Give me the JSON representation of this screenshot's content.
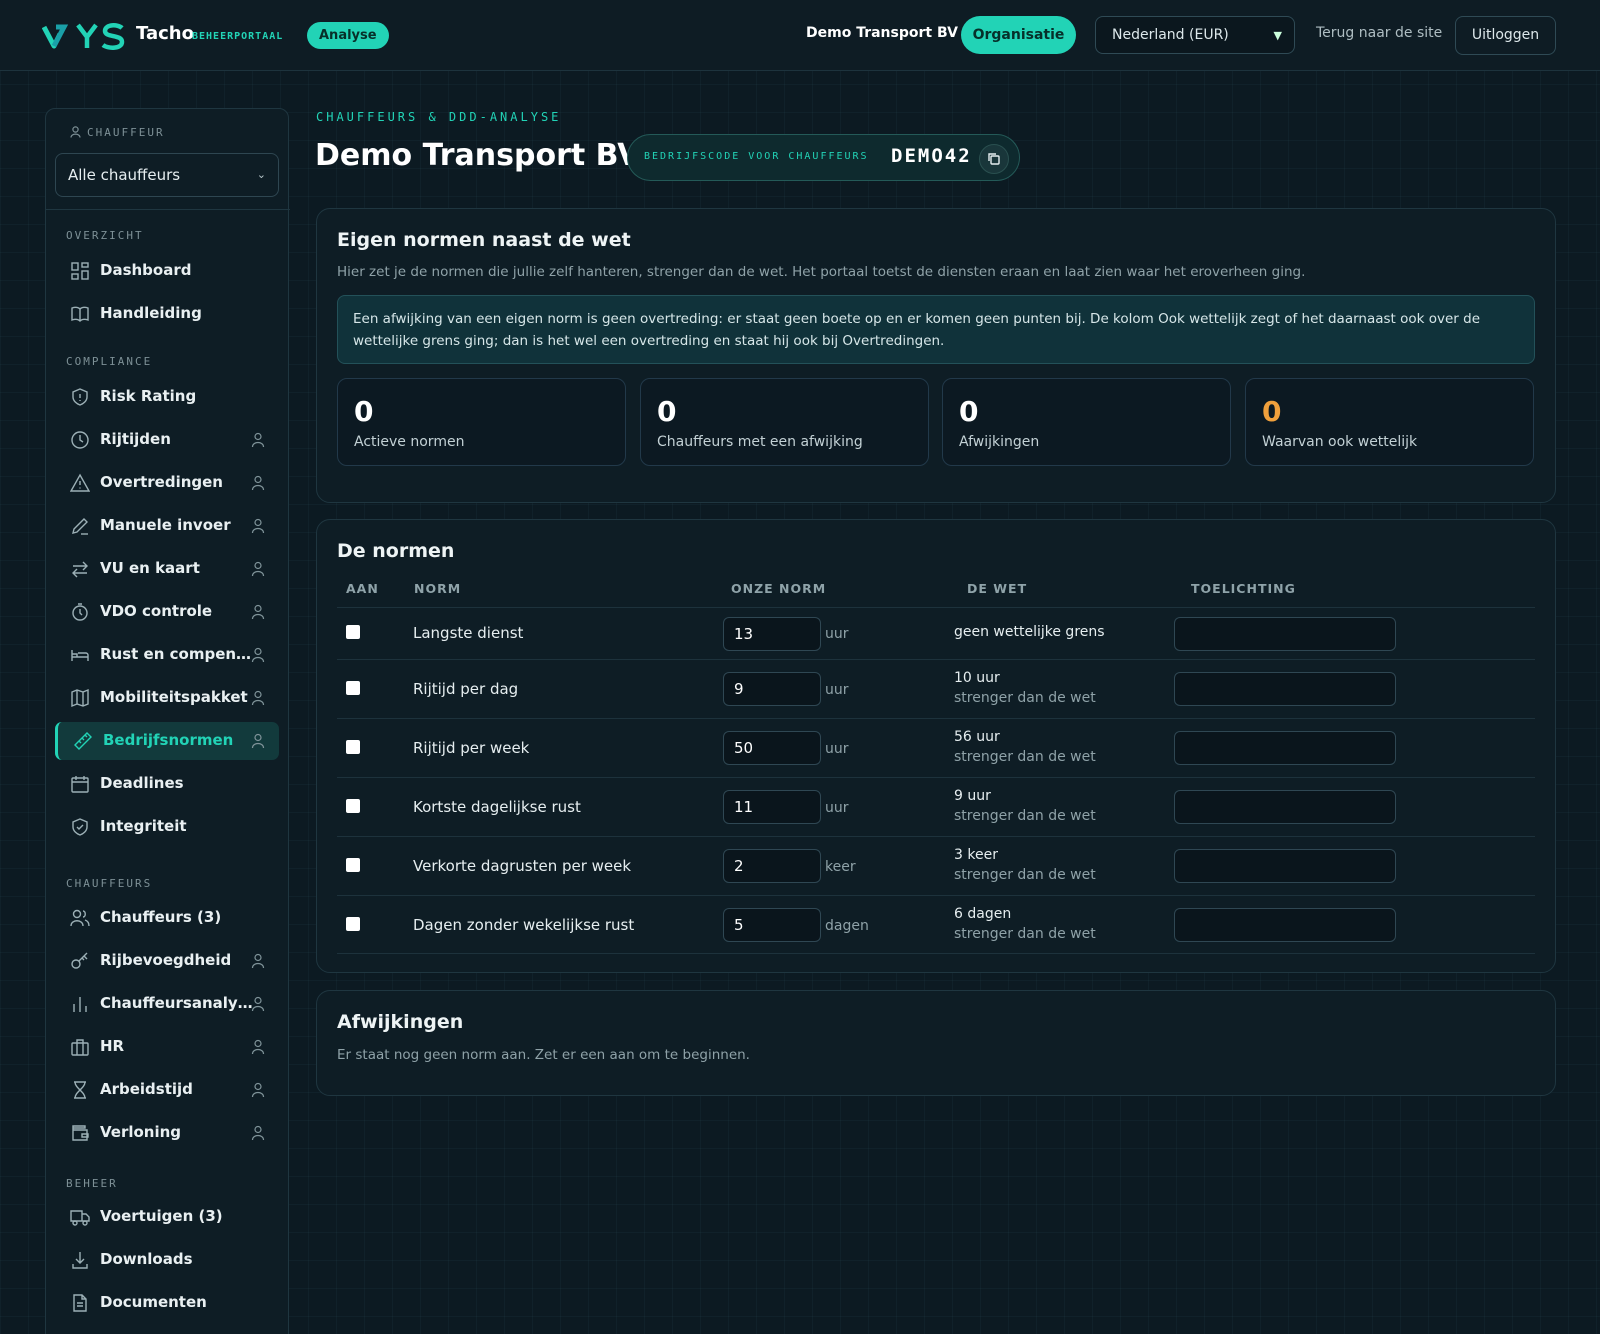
{
  "header": {
    "brand": "Tacho",
    "portal": "BEHEERPORTAAL",
    "badge": "Analyse",
    "org_name": "Demo Transport BV",
    "org_button": "Organisatie",
    "country_select": "Nederland (EUR)",
    "back_link": "Terug naar de site",
    "logout": "Uitloggen"
  },
  "sidebar": {
    "driver_label": "CHAUFFEUR",
    "driver_select": "Alle chauffeurs",
    "sections": {
      "overzicht": "OVERZICHT",
      "compliance": "COMPLIANCE",
      "chauffeurs": "CHAUFFEURS",
      "beheer": "BEHEER"
    },
    "items": [
      {
        "label": "Dashboard",
        "icon": "dashboard-icon"
      },
      {
        "label": "Handleiding",
        "icon": "book-icon"
      },
      {
        "label": "Risk Rating",
        "icon": "shield-icon"
      },
      {
        "label": "Rijtijden",
        "icon": "clock-icon"
      },
      {
        "label": "Overtredingen",
        "icon": "warning-icon"
      },
      {
        "label": "Manuele invoer",
        "icon": "pencil-icon"
      },
      {
        "label": "VU en kaart",
        "icon": "arrows-icon"
      },
      {
        "label": "VDO controle",
        "icon": "timer-icon"
      },
      {
        "label": "Rust en compen…",
        "icon": "bed-icon"
      },
      {
        "label": "Mobiliteitspakket",
        "icon": "map-icon"
      },
      {
        "label": "Bedrijfsnormen",
        "icon": "ruler-icon"
      },
      {
        "label": "Deadlines",
        "icon": "calendar-icon"
      },
      {
        "label": "Integriteit",
        "icon": "shield-check-icon"
      },
      {
        "label": "Chauffeurs (3)",
        "icon": "users-icon"
      },
      {
        "label": "Rijbevoegdheid",
        "icon": "key-icon"
      },
      {
        "label": "Chauffeursanaly…",
        "icon": "bar-chart-icon"
      },
      {
        "label": "HR",
        "icon": "briefcase-icon"
      },
      {
        "label": "Arbeidstijd",
        "icon": "hourglass-icon"
      },
      {
        "label": "Verloning",
        "icon": "wallet-icon"
      },
      {
        "label": "Voertuigen (3)",
        "icon": "truck-icon"
      },
      {
        "label": "Downloads",
        "icon": "download-icon"
      },
      {
        "label": "Documenten",
        "icon": "document-icon"
      }
    ]
  },
  "page": {
    "kicker": "CHAUFFEURS & DDD-ANALYSE",
    "title": "Demo Transport BV",
    "code_label": "BEDRIJFSCODE VOOR CHAUFFEURS",
    "code_value": "DEMO42"
  },
  "norms_intro": {
    "title": "Eigen normen naast de wet",
    "description": "Hier zet je de normen die jullie zelf hanteren, strenger dan de wet. Het portaal toetst de diensten eraan en laat zien waar het eroverheen ging.",
    "notice": "Een afwijking van een eigen norm is geen overtreding: er staat geen boete op en er komen geen punten bij. De kolom Ook wettelijk zegt of het daarnaast ook over de wettelijke grens ging; dan is het wel een overtreding en staat hij ook bij Overtredingen.",
    "stats": [
      {
        "value": "0",
        "label": "Actieve normen"
      },
      {
        "value": "0",
        "label": "Chauffeurs met een afwijking"
      },
      {
        "value": "0",
        "label": "Afwijkingen"
      },
      {
        "value": "0",
        "label": "Waarvan ook wettelijk"
      }
    ],
    "accent_color": "#f0a03c"
  },
  "norms_table": {
    "title": "De normen",
    "columns": [
      "AAN",
      "NORM",
      "ONZE NORM",
      "DE WET",
      "TOELICHTING"
    ],
    "rows": [
      {
        "name": "Langste dienst",
        "value": "13",
        "unit": "uur",
        "law": "geen wettelijke grens",
        "law_note": ""
      },
      {
        "name": "Rijtijd per dag",
        "value": "9",
        "unit": "uur",
        "law": "10 uur",
        "law_note": "strenger dan de wet"
      },
      {
        "name": "Rijtijd per week",
        "value": "50",
        "unit": "uur",
        "law": "56 uur",
        "law_note": "strenger dan de wet"
      },
      {
        "name": "Kortste dagelijkse rust",
        "value": "11",
        "unit": "uur",
        "law": "9 uur",
        "law_note": "strenger dan de wet"
      },
      {
        "name": "Verkorte dagrusten per week",
        "value": "2",
        "unit": "keer",
        "law": "3 keer",
        "law_note": "strenger dan de wet"
      },
      {
        "name": "Dagen zonder wekelijkse rust",
        "value": "5",
        "unit": "dagen",
        "law": "6 dagen",
        "law_note": "strenger dan de wet"
      }
    ]
  },
  "deviations": {
    "title": "Afwijkingen",
    "empty": "Er staat nog geen norm aan. Zet er een aan om te beginnen."
  }
}
